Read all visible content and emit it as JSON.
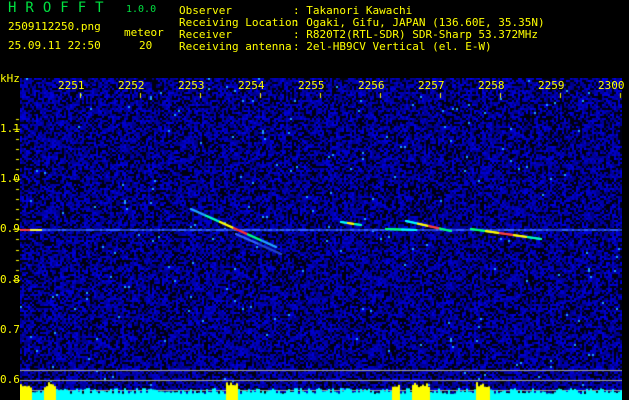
{
  "header": {
    "brand": "HROFFT",
    "version": "1.0.0",
    "filename": "2509112250.png",
    "datetime": "25.09.11 22:50",
    "count_label": "meteor",
    "count_value": "20"
  },
  "info": [
    {
      "label": "Observer",
      "value": "Takanori Kawachi"
    },
    {
      "label": "Receiving Location",
      "value": "Ogaki, Gifu, JAPAN (136.60E, 35.35N)"
    },
    {
      "label": "Receiver",
      "value": "R820T2(RTL-SDR) SDR-Sharp 53.372MHz"
    },
    {
      "label": "Receiving antenna",
      "value": "2el-HB9CV Vertical (el. E-W)"
    }
  ],
  "y_axis": {
    "unit": "kHz",
    "ticks": [
      "1.1",
      "1.0",
      "0.9",
      "0.8",
      "0.7",
      "0.6"
    ]
  },
  "x_axis": {
    "ticks": [
      "2251",
      "2252",
      "2253",
      "2254",
      "2255",
      "2256",
      "2257",
      "2258",
      "2259",
      "2300"
    ]
  },
  "colors": {
    "text": "#ffff00",
    "brand": "#00e040",
    "noise": "#0000c0",
    "bars": "#00ffff",
    "bar_highlight": "#ffff00"
  }
}
